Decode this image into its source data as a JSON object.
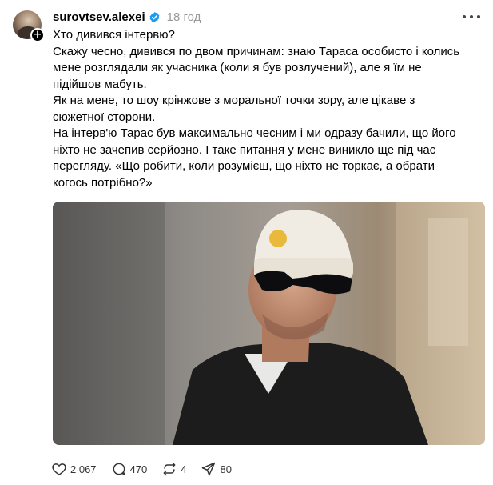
{
  "post": {
    "username": "surovtsev.alexei",
    "time": "18 год",
    "paragraphs": [
      "Хто дивився інтервю?",
      "Скажу чесно, дивився по двом причинам: знаю Тараса особисто і колись\nмене розглядали як учасника (коли я був розлучений), але я їм не\nпідійшов мабуть.",
      "Як на мене, то шоу крінжове з моральної точки зору, але цікаве з\nсюжетної сторони.",
      "На інтерв'ю Тарас був максимально чесним і ми одразу бачили, що його\nніхто не зачепив серйозно. І таке питання у мене виникло ще під час\nперегляду. «Що робити, коли розумієш, що ніхто не торкає, а обрати\nкогось потрібно?»"
    ]
  },
  "actions": {
    "likes": "2 067",
    "comments": "470",
    "reposts": "4",
    "shares": "80"
  },
  "colors": {
    "verified": "#1d9bf0",
    "muted": "#999999"
  }
}
